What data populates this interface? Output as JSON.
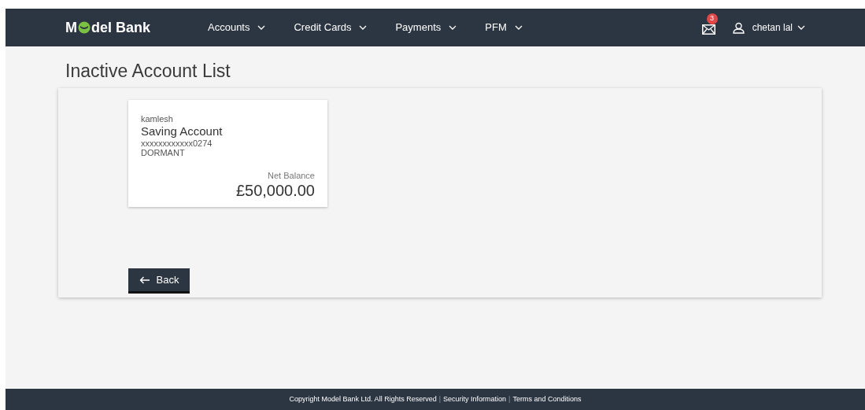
{
  "header": {
    "logo": {
      "before": "M",
      "after": "del Bank"
    },
    "nav": [
      {
        "label": "Accounts"
      },
      {
        "label": "Credit Cards"
      },
      {
        "label": "Payments"
      },
      {
        "label": "PFM"
      }
    ],
    "mail_badge": "3",
    "user": "chetan lal"
  },
  "page_title": "Inactive Account List",
  "accounts": [
    {
      "holder": "kamlesh",
      "type": "Saving Account",
      "number": "xxxxxxxxxxxx0274",
      "status": "DORMANT",
      "balance_label": "Net Balance",
      "balance": "£50,000.00"
    }
  ],
  "back_button": "Back",
  "footer": {
    "copyright": "Copyright Model Bank Ltd. All Rights Reserved",
    "separators": [
      "|",
      "|"
    ],
    "links": [
      "Security Information",
      "Terms and Conditions"
    ]
  }
}
